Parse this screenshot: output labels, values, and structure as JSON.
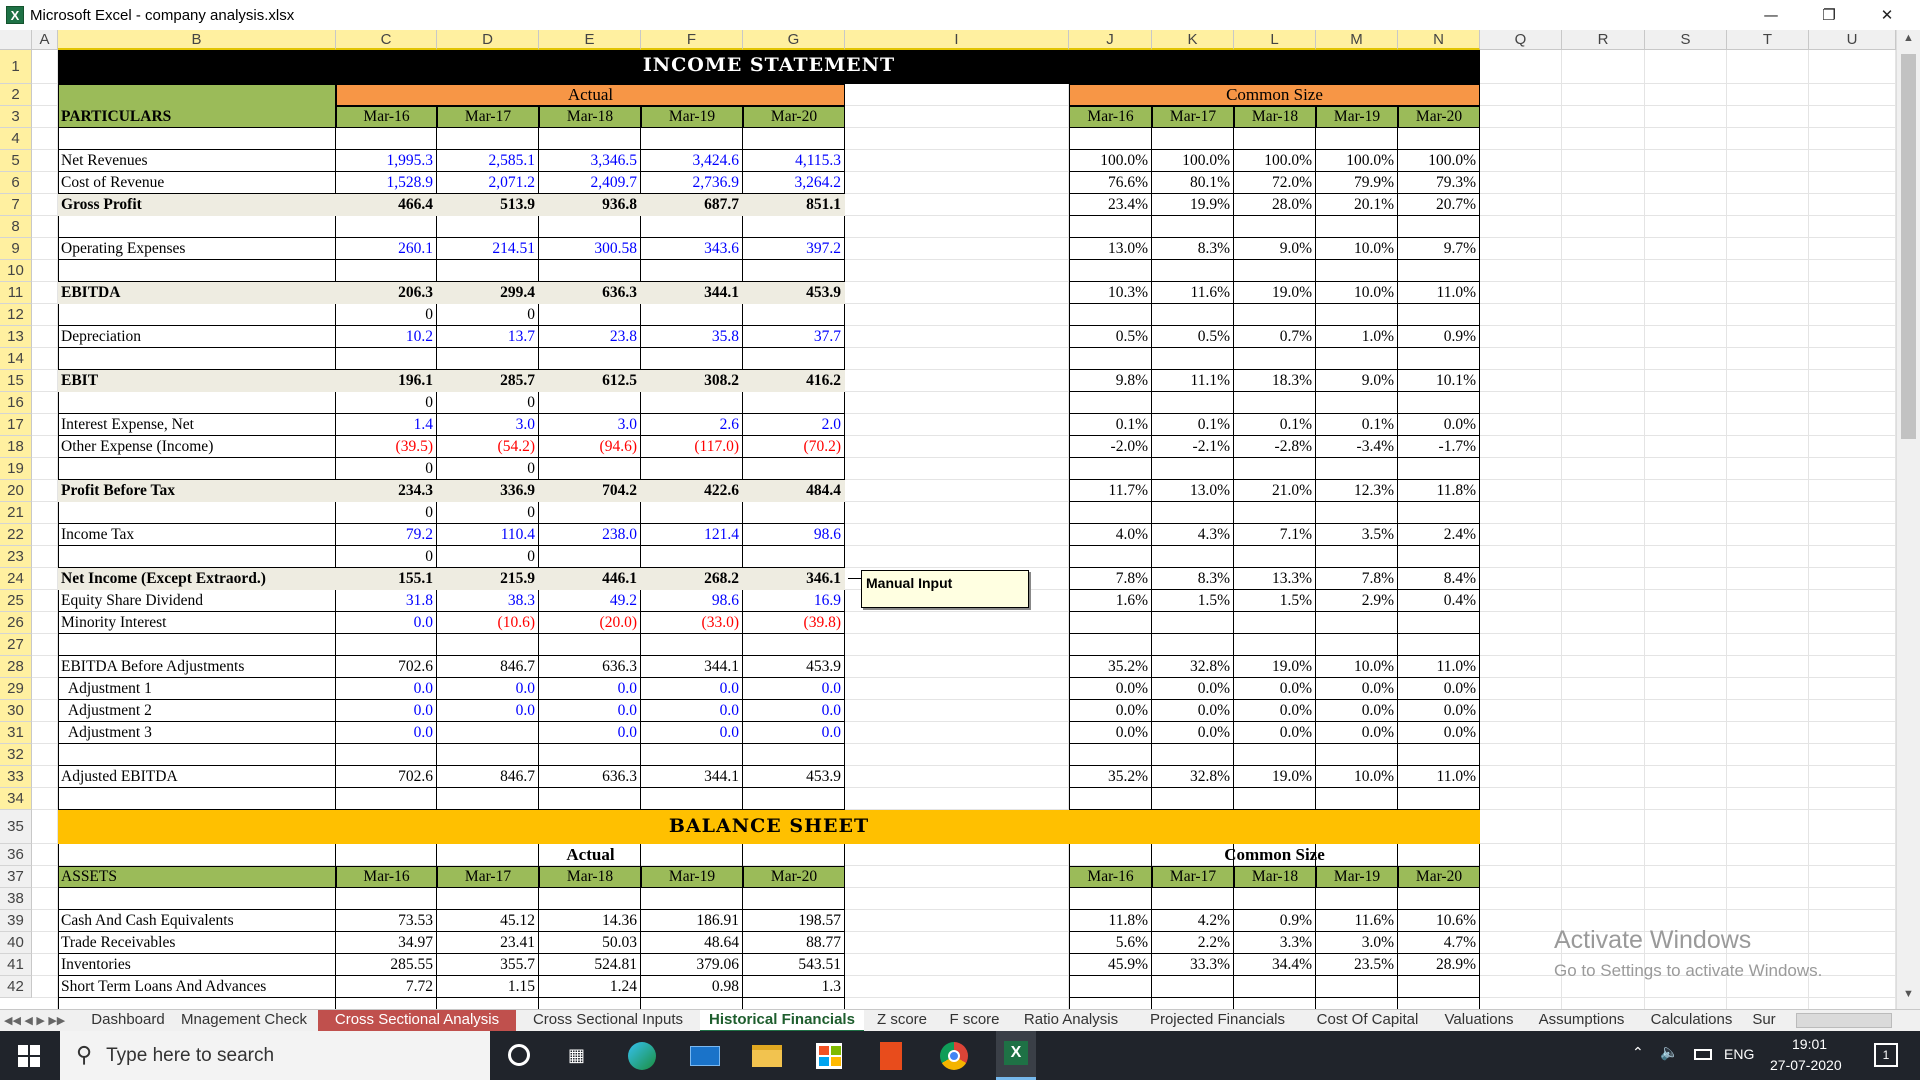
{
  "window": {
    "title": "Microsoft Excel - company analysis.xlsx",
    "logo": "X"
  },
  "grid_cols": [
    "A",
    "B",
    "C",
    "D",
    "E",
    "F",
    "G",
    "I",
    "J",
    "K",
    "L",
    "M",
    "N",
    "Q",
    "R",
    "S",
    "T",
    "U"
  ],
  "rows": [
    "1",
    "2",
    "3",
    "4",
    "5",
    "6",
    "7",
    "8",
    "9",
    "10",
    "11",
    "12",
    "13",
    "14",
    "15",
    "16",
    "17",
    "18",
    "19",
    "20",
    "21",
    "22",
    "23",
    "24",
    "25",
    "26",
    "27",
    "28",
    "29",
    "30",
    "31",
    "32",
    "33",
    "34",
    "35",
    "36",
    "37",
    "38",
    "39",
    "40",
    "41",
    "42"
  ],
  "income": {
    "title": "INCOME STATEMENT",
    "group_actual": "Actual",
    "group_cs": "Common Size",
    "particulars": "PARTICULARS",
    "periods": [
      "Mar-16",
      "Mar-17",
      "Mar-18",
      "Mar-19",
      "Mar-20"
    ],
    "lines": [
      {
        "row": 5,
        "label": "Net Revenues",
        "bold": false,
        "color": "blue",
        "vals": [
          "1,995.3",
          "2,585.1",
          "3,346.5",
          "3,424.6",
          "4,115.3"
        ],
        "cs": [
          "100.0%",
          "100.0%",
          "100.0%",
          "100.0%",
          "100.0%"
        ]
      },
      {
        "row": 6,
        "label": "Cost of Revenue",
        "bold": false,
        "color": "blue",
        "vals": [
          "1,528.9",
          "2,071.2",
          "2,409.7",
          "2,736.9",
          "3,264.2"
        ],
        "cs": [
          "76.6%",
          "80.1%",
          "72.0%",
          "79.9%",
          "79.3%"
        ]
      },
      {
        "row": 7,
        "label": "Gross Profit",
        "bold": true,
        "shade": true,
        "color": "black",
        "vals": [
          "466.4",
          "513.9",
          "936.8",
          "687.7",
          "851.1"
        ],
        "cs": [
          "23.4%",
          "19.9%",
          "28.0%",
          "20.1%",
          "20.7%"
        ]
      },
      {
        "row": 9,
        "label": "Operating Expenses",
        "bold": false,
        "color": "blue",
        "vals": [
          "260.1",
          "214.51",
          "300.58",
          "343.6",
          "397.2"
        ],
        "cs": [
          "13.0%",
          "8.3%",
          "9.0%",
          "10.0%",
          "9.7%"
        ]
      },
      {
        "row": 11,
        "label": "EBITDA",
        "bold": true,
        "shade": true,
        "color": "black",
        "vals": [
          "206.3",
          "299.4",
          "636.3",
          "344.1",
          "453.9"
        ],
        "cs": [
          "10.3%",
          "11.6%",
          "19.0%",
          "10.0%",
          "11.0%"
        ]
      },
      {
        "row": 12,
        "label": "",
        "color": "black",
        "vals": [
          "0",
          "0",
          "",
          "",
          ""
        ],
        "cs": [
          "",
          "",
          "",
          "",
          ""
        ]
      },
      {
        "row": 13,
        "label": "Depreciation",
        "bold": false,
        "color": "blue",
        "vals": [
          "10.2",
          "13.7",
          "23.8",
          "35.8",
          "37.7"
        ],
        "cs": [
          "0.5%",
          "0.5%",
          "0.7%",
          "1.0%",
          "0.9%"
        ]
      },
      {
        "row": 15,
        "label": "EBIT",
        "bold": true,
        "shade": true,
        "color": "black",
        "vals": [
          "196.1",
          "285.7",
          "612.5",
          "308.2",
          "416.2"
        ],
        "cs": [
          "9.8%",
          "11.1%",
          "18.3%",
          "9.0%",
          "10.1%"
        ]
      },
      {
        "row": 16,
        "label": "",
        "color": "black",
        "vals": [
          "0",
          "0",
          "",
          "",
          ""
        ],
        "cs": [
          "",
          "",
          "",
          "",
          ""
        ]
      },
      {
        "row": 17,
        "label": "Interest Expense, Net",
        "bold": false,
        "color": "blue",
        "vals": [
          "1.4",
          "3.0",
          "3.0",
          "2.6",
          "2.0"
        ],
        "cs": [
          "0.1%",
          "0.1%",
          "0.1%",
          "0.1%",
          "0.0%"
        ]
      },
      {
        "row": 18,
        "label": "Other Expense (Income)",
        "bold": false,
        "color": "red",
        "vals": [
          "(39.5)",
          "(54.2)",
          "(94.6)",
          "(117.0)",
          "(70.2)"
        ],
        "cs": [
          "-2.0%",
          "-2.1%",
          "-2.8%",
          "-3.4%",
          "-1.7%"
        ]
      },
      {
        "row": 19,
        "label": "",
        "color": "black",
        "vals": [
          "0",
          "0",
          "",
          "",
          ""
        ],
        "cs": [
          "",
          "",
          "",
          "",
          ""
        ]
      },
      {
        "row": 20,
        "label": "Profit Before Tax",
        "bold": true,
        "shade": true,
        "color": "black",
        "vals": [
          "234.3",
          "336.9",
          "704.2",
          "422.6",
          "484.4"
        ],
        "cs": [
          "11.7%",
          "13.0%",
          "21.0%",
          "12.3%",
          "11.8%"
        ]
      },
      {
        "row": 21,
        "label": "",
        "color": "black",
        "vals": [
          "0",
          "0",
          "",
          "",
          ""
        ],
        "cs": [
          "",
          "",
          "",
          "",
          ""
        ]
      },
      {
        "row": 22,
        "label": "Income Tax",
        "bold": false,
        "color": "blue",
        "vals": [
          "79.2",
          "110.4",
          "238.0",
          "121.4",
          "98.6"
        ],
        "cs": [
          "4.0%",
          "4.3%",
          "7.1%",
          "3.5%",
          "2.4%"
        ]
      },
      {
        "row": 23,
        "label": "",
        "color": "black",
        "vals": [
          "0",
          "0",
          "",
          "",
          ""
        ],
        "cs": [
          "",
          "",
          "",
          "",
          ""
        ]
      },
      {
        "row": 24,
        "label": "Net Income (Except Extraord.)",
        "bold": true,
        "shade": true,
        "color": "black",
        "vals": [
          "155.1",
          "215.9",
          "446.1",
          "268.2",
          "346.1"
        ],
        "cs": [
          "7.8%",
          "8.3%",
          "13.3%",
          "7.8%",
          "8.4%"
        ]
      },
      {
        "row": 25,
        "label": "Equity Share Dividend",
        "bold": false,
        "color": "blue",
        "vals": [
          "31.8",
          "38.3",
          "49.2",
          "98.6",
          "16.9"
        ],
        "cs": [
          "1.6%",
          "1.5%",
          "1.5%",
          "2.9%",
          "0.4%"
        ]
      },
      {
        "row": 26,
        "label": "Minority Interest",
        "bold": false,
        "color": "blue",
        "mixed": true,
        "vals": [
          "0.0",
          "(10.6)",
          "(20.0)",
          "(33.0)",
          "(39.8)"
        ],
        "cs": [
          "",
          "",
          "",
          "",
          ""
        ]
      },
      {
        "row": 28,
        "label": "EBITDA Before Adjustments",
        "bold": false,
        "color": "black",
        "vals": [
          "702.6",
          "846.7",
          "636.3",
          "344.1",
          "453.9"
        ],
        "cs": [
          "35.2%",
          "32.8%",
          "19.0%",
          "10.0%",
          "11.0%"
        ]
      },
      {
        "row": 29,
        "label": "  Adjustment 1",
        "bold": false,
        "color": "blue",
        "vals": [
          "0.0",
          "0.0",
          "0.0",
          "0.0",
          "0.0"
        ],
        "cs": [
          "0.0%",
          "0.0%",
          "0.0%",
          "0.0%",
          "0.0%"
        ]
      },
      {
        "row": 30,
        "label": "  Adjustment 2",
        "bold": false,
        "color": "blue",
        "vals": [
          "0.0",
          "0.0",
          "0.0",
          "0.0",
          "0.0"
        ],
        "cs": [
          "0.0%",
          "0.0%",
          "0.0%",
          "0.0%",
          "0.0%"
        ]
      },
      {
        "row": 31,
        "label": "  Adjustment 3",
        "bold": false,
        "color": "blue",
        "vals": [
          "0.0",
          "",
          "0.0",
          "0.0",
          "0.0"
        ],
        "cs": [
          "0.0%",
          "0.0%",
          "0.0%",
          "0.0%",
          "0.0%"
        ]
      },
      {
        "row": 33,
        "label": "Adjusted EBITDA",
        "bold": false,
        "color": "black",
        "vals": [
          "702.6",
          "846.7",
          "636.3",
          "344.1",
          "453.9"
        ],
        "cs": [
          "35.2%",
          "32.8%",
          "19.0%",
          "10.0%",
          "11.0%"
        ]
      }
    ],
    "comment": "Manual Input"
  },
  "balance": {
    "title": "BALANCE SHEET",
    "group_actual": "Actual",
    "group_cs": "Common Size",
    "assets": "ASSETS",
    "lines": [
      {
        "row": 39,
        "label": "Cash And Cash Equivalents",
        "vals": [
          "73.53",
          "45.12",
          "14.36",
          "186.91",
          "198.57"
        ],
        "cs": [
          "11.8%",
          "4.2%",
          "0.9%",
          "11.6%",
          "10.6%"
        ]
      },
      {
        "row": 40,
        "label": "Trade Receivables",
        "vals": [
          "34.97",
          "23.41",
          "50.03",
          "48.64",
          "88.77"
        ],
        "cs": [
          "5.6%",
          "2.2%",
          "3.3%",
          "3.0%",
          "4.7%"
        ]
      },
      {
        "row": 41,
        "label": "Inventories",
        "vals": [
          "285.55",
          "355.7",
          "524.81",
          "379.06",
          "543.51"
        ],
        "cs": [
          "45.9%",
          "33.3%",
          "34.4%",
          "23.5%",
          "28.9%"
        ]
      },
      {
        "row": 42,
        "label": "Short Term Loans And Advances",
        "vals": [
          "7.72",
          "1.15",
          "1.24",
          "0.98",
          "1.3"
        ],
        "cs": [
          "",
          "",
          "",
          "",
          ""
        ]
      }
    ]
  },
  "tabs": [
    {
      "label": "Dashboard",
      "active": false
    },
    {
      "label": "Mnagement Check",
      "active": false
    },
    {
      "label": "Cross Sectional Analysis",
      "active": false,
      "red": true
    },
    {
      "label": "Cross Sectional Inputs",
      "active": false
    },
    {
      "label": "Historical Financials",
      "active": true
    },
    {
      "label": "Z score",
      "active": false
    },
    {
      "label": "F score",
      "active": false
    },
    {
      "label": "Ratio Analysis",
      "active": false
    },
    {
      "label": "Projected Financials",
      "active": false
    },
    {
      "label": "Cost Of Capital",
      "active": false
    },
    {
      "label": "Valuations",
      "active": false
    },
    {
      "label": "Assumptions",
      "active": false
    },
    {
      "label": "Calculations",
      "active": false
    },
    {
      "label": "Sur",
      "active": false
    }
  ],
  "watermark": {
    "line1": "Activate Windows",
    "line2": "Go to Settings to activate Windows."
  },
  "taskbar": {
    "search_placeholder": "Type here to search",
    "lang": "ENG",
    "time": "19:01",
    "date": "27-07-2020",
    "notif": "1"
  },
  "colors": {
    "green": "#9bbb59",
    "orange": "#f79646",
    "gold": "#ffc000",
    "black": "#000000",
    "shade": "#eeece1"
  }
}
